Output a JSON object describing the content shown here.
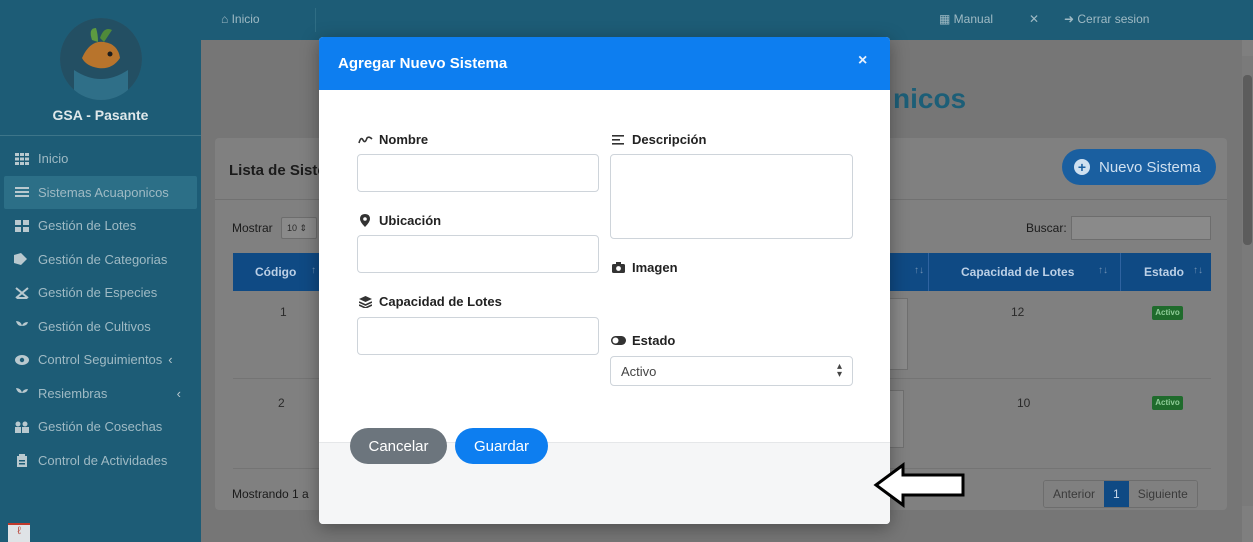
{
  "sidebar": {
    "brand": "GSA - Pasante",
    "items": [
      {
        "label": "Inicio",
        "icon": "grid-icon"
      },
      {
        "label": "Sistemas Acuaponicos",
        "icon": "list-icon"
      },
      {
        "label": "Gestión de Lotes",
        "icon": "blocks-icon"
      },
      {
        "label": "Gestión de Categorias",
        "icon": "tag-icon"
      },
      {
        "label": "Gestión de Especies",
        "icon": "fish-icon"
      },
      {
        "label": "Gestión de Cultivos",
        "icon": "seedling-icon"
      },
      {
        "label": "Control Seguimientos",
        "icon": "eye-icon"
      },
      {
        "label": "Resiembras",
        "icon": "seedling-icon"
      },
      {
        "label": "Gestión de Cosechas",
        "icon": "people-icon"
      },
      {
        "label": "Control de Actividades",
        "icon": "clipboard-icon"
      }
    ]
  },
  "topbar": {
    "inicio": "Inicio",
    "manual": "Manual",
    "cerrar": "Cerrar sesion"
  },
  "page": {
    "title_fragment": "nicos",
    "card_title": "Lista de Siste",
    "new_button": "Nuevo Sistema",
    "mostrar": "Mostrar",
    "mostrar_value": "10",
    "buscar": "Buscar:",
    "mostrando": "Mostrando 1 a",
    "pager": {
      "prev": "Anterior",
      "current": "1",
      "next": "Siguiente"
    }
  },
  "table": {
    "headers": {
      "codigo": "Código",
      "capacidad": "Capacidad de Lotes",
      "estado": "Estado"
    },
    "rows": [
      {
        "codigo": "1",
        "capacidad": "12",
        "estado": "Activo"
      },
      {
        "codigo": "2",
        "capacidad": "10",
        "estado": "Activo"
      }
    ]
  },
  "modal": {
    "title": "Agregar Nuevo Sistema",
    "close": "×",
    "fields": {
      "nombre": {
        "label": "Nombre",
        "value": "",
        "placeholder": ""
      },
      "descripcion": {
        "label": "Descripción",
        "value": "",
        "placeholder": ""
      },
      "ubicacion": {
        "label": "Ubicación",
        "value": "",
        "placeholder": ""
      },
      "imagen": {
        "label": "Imagen"
      },
      "capacidad": {
        "label": "Capacidad de Lotes",
        "value": "",
        "placeholder": ""
      },
      "estado": {
        "label": "Estado",
        "value": "Activo"
      }
    },
    "cancel": "Cancelar",
    "save": "Guardar"
  },
  "colors": {
    "primary": "#0d7ef0",
    "secondary": "#6c757d",
    "sidebar": "#1d5c76"
  }
}
